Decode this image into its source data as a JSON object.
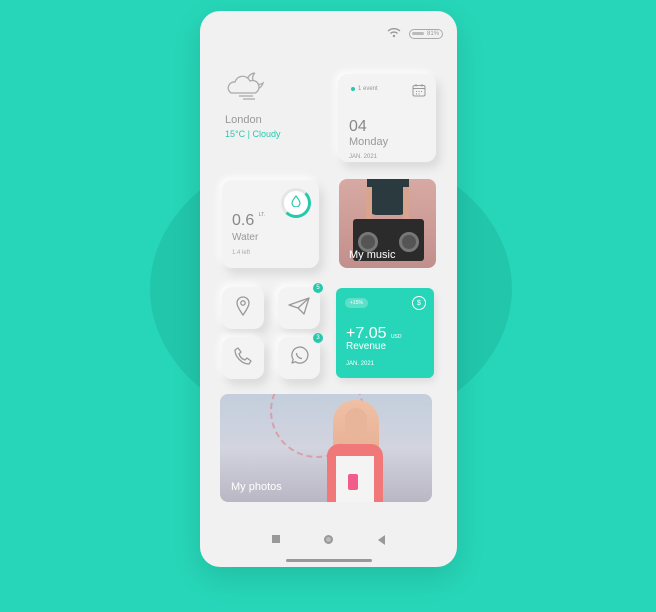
{
  "status": {
    "battery": "81%"
  },
  "weather": {
    "icon": "cloud-moon-icon",
    "city": "London",
    "temp": "15°C",
    "separator": "|",
    "condition": "Cloudy"
  },
  "calendar": {
    "event_count": "1 event",
    "day_number": "04",
    "weekday": "Monday",
    "month_year": "JAN. 2021"
  },
  "water": {
    "value": "0.6",
    "unit": "LT.",
    "label": "Water",
    "remaining": "1.4 left"
  },
  "music": {
    "label": "My music"
  },
  "shortcuts": {
    "telegram_badge": "5",
    "whatsapp_badge": "3"
  },
  "revenue": {
    "change": "+15%",
    "currency_symbol": "$",
    "value": "+7.05",
    "unit": "USD",
    "label": "Revenue",
    "date": "JAN. 2021"
  },
  "photos": {
    "label": "My photos"
  },
  "colors": {
    "accent": "#27d6b8",
    "card": "#f3f3f3",
    "text_muted": "#999999"
  }
}
